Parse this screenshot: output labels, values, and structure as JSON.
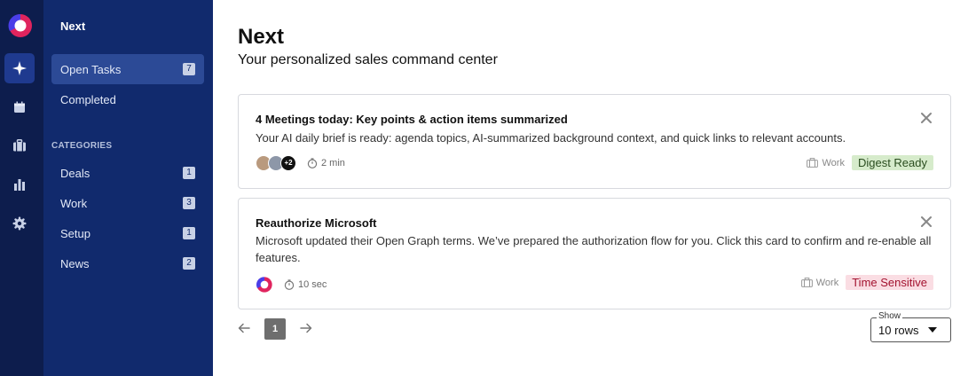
{
  "sidebar": {
    "title": "Next",
    "open_tasks": {
      "label": "Open Tasks",
      "count": "7"
    },
    "completed": {
      "label": "Completed"
    },
    "categories_heading": "CATEGORIES",
    "categories": [
      {
        "label": "Deals",
        "count": "1"
      },
      {
        "label": "Work",
        "count": "3"
      },
      {
        "label": "Setup",
        "count": "1"
      },
      {
        "label": "News",
        "count": "2"
      }
    ]
  },
  "header": {
    "title": "Next",
    "subtitle": "Your personalized sales command center"
  },
  "cards": [
    {
      "title": "4 Meetings today: Key points & action items summarized",
      "description": "Your AI daily brief is ready: agenda topics, AI-summarized background context, and quick links to relevant accounts.",
      "extra_avatars": "+2",
      "time": "2 min",
      "category": "Work",
      "tag": "Digest Ready",
      "tag_color": "#d6ebcb"
    },
    {
      "title": "Reauthorize Microsoft",
      "description": "Microsoft updated their Open Graph terms. We’ve prepared the authorization flow for you. Click this card to confirm and re-enable all features.",
      "time": "10 sec",
      "category": "Work",
      "tag": "Time Sensitive",
      "tag_color": "#fadde3"
    }
  ],
  "pagination": {
    "current_page": "1",
    "prev_icon": "arrow-left-icon",
    "next_icon": "arrow-right-icon"
  },
  "rows_select": {
    "legend": "Show",
    "value": "10 rows"
  },
  "colors": {
    "rail_bg": "#0d1d4d",
    "sidebar_bg": "#112a6d",
    "active_item": "#2c4a96",
    "brand_red": "#e0245e",
    "brand_blue": "#4a3ee8"
  }
}
